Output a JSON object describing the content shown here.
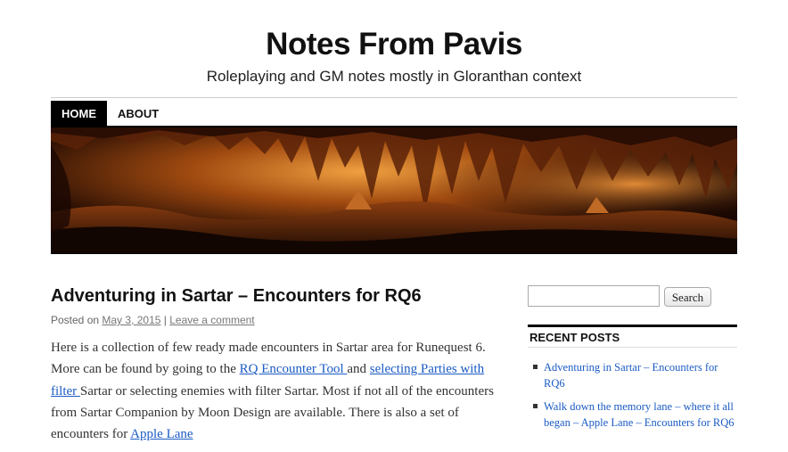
{
  "site": {
    "title": "Notes From Pavis",
    "description": "Roleplaying and GM notes mostly in Gloranthan context"
  },
  "nav": [
    {
      "label": "HOME",
      "active": true
    },
    {
      "label": "ABOUT",
      "active": false
    }
  ],
  "banner": {
    "icon": "cave-photo"
  },
  "post": {
    "title": "Adventuring in Sartar – Encounters for RQ6",
    "posted_on": "Posted on",
    "date": "May 3, 2015",
    "separator": "|",
    "comment_link": "Leave a comment",
    "body_1": "Here is a collection of few ready made encounters in Sartar area for Runequest 6. More can be found by going to the",
    "link_1": "RQ Encounter Tool ",
    "body_2": "and",
    "link_2": "selecting Parties with filter ",
    "body_3": "Sartar or selecting enemies with filter Sartar. Most if not all of the encounters from Sartar Companion by Moon Design are available. There is also a set of encounters for",
    "link_3": "Apple Lane"
  },
  "sidebar": {
    "search_placeholder": "",
    "search_button": "Search",
    "recent_title": "RECENT POSTS",
    "recent_posts": [
      "Adventuring in Sartar – Encounters for RQ6",
      "Walk down the memory lane – where it all began – Apple Lane – Encounters for RQ6"
    ]
  },
  "colors": {
    "link": "#1b5bc4",
    "nav_active_bg": "#000000"
  }
}
